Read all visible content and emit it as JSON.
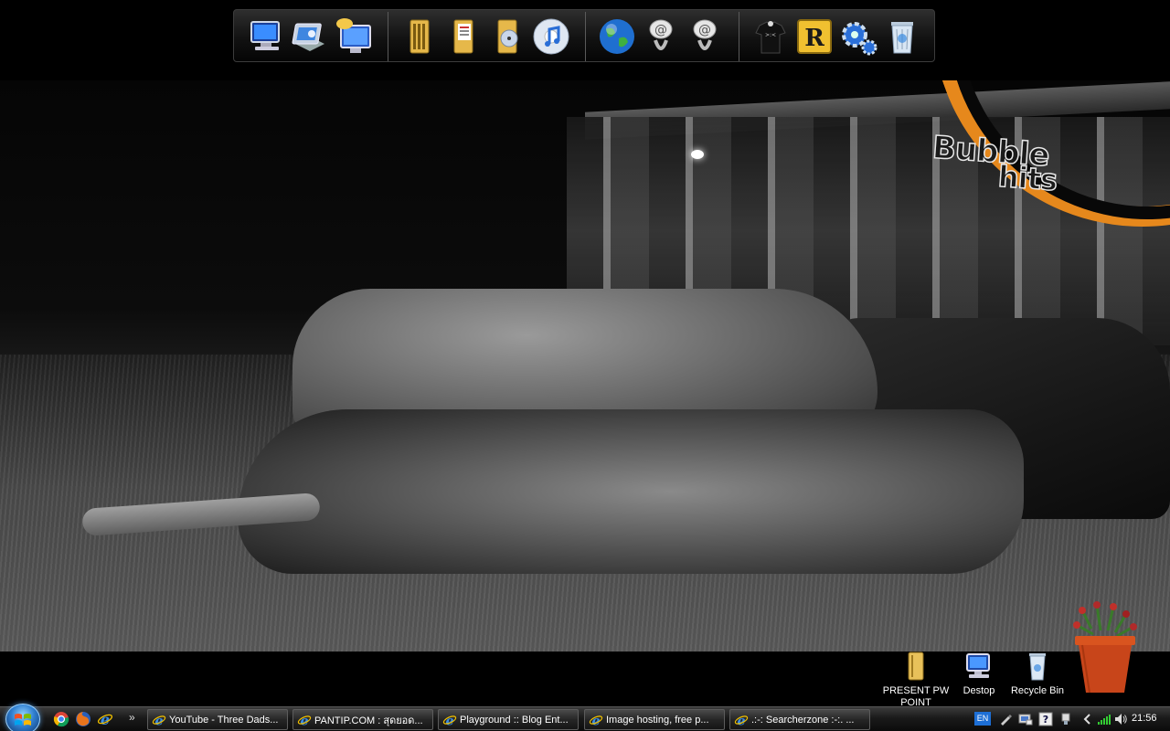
{
  "wallpaper": {
    "logo_word1": "Bubble",
    "logo_word2": "hits"
  },
  "dock": {
    "icons": [
      "computer-icon",
      "network-drive-icon",
      "remote-desktop-icon",
      "folder-icon",
      "documents-folder-icon",
      "music-folder-icon",
      "itunes-icon",
      "internet-globe-icon",
      "email-at-icon",
      "email-at-icon-2",
      "tshirt-icon",
      "rocketdock-r-icon",
      "settings-gear-icon",
      "recycle-bin-icon"
    ]
  },
  "desktop_icons": [
    {
      "label": "PRESENT  PW POINT",
      "icon": "folder-icon"
    },
    {
      "label": "Destop",
      "icon": "desktop-computer-icon"
    },
    {
      "label": "Recycle Bin",
      "icon": "recycle-bin-icon"
    }
  ],
  "taskbar": {
    "quick_launch": [
      "chrome-icon",
      "firefox-icon",
      "internet-explorer-icon"
    ],
    "quick_launch_more": "»",
    "tasks": [
      {
        "label": "YouTube - Three Dads..."
      },
      {
        "label": "PANTIP.COM : สุดยอด..."
      },
      {
        "label": "Playground :: Blog Ent..."
      },
      {
        "label": "Image hosting, free p..."
      },
      {
        "label": ".:-: Searcherzone :-:. ..."
      }
    ],
    "tray": {
      "language": "EN",
      "time": "21:56"
    }
  },
  "colors": {
    "logo_orange": "#e6881c",
    "start_orb": "#2f7fd0",
    "lang_badge": "#1d6fd6"
  }
}
